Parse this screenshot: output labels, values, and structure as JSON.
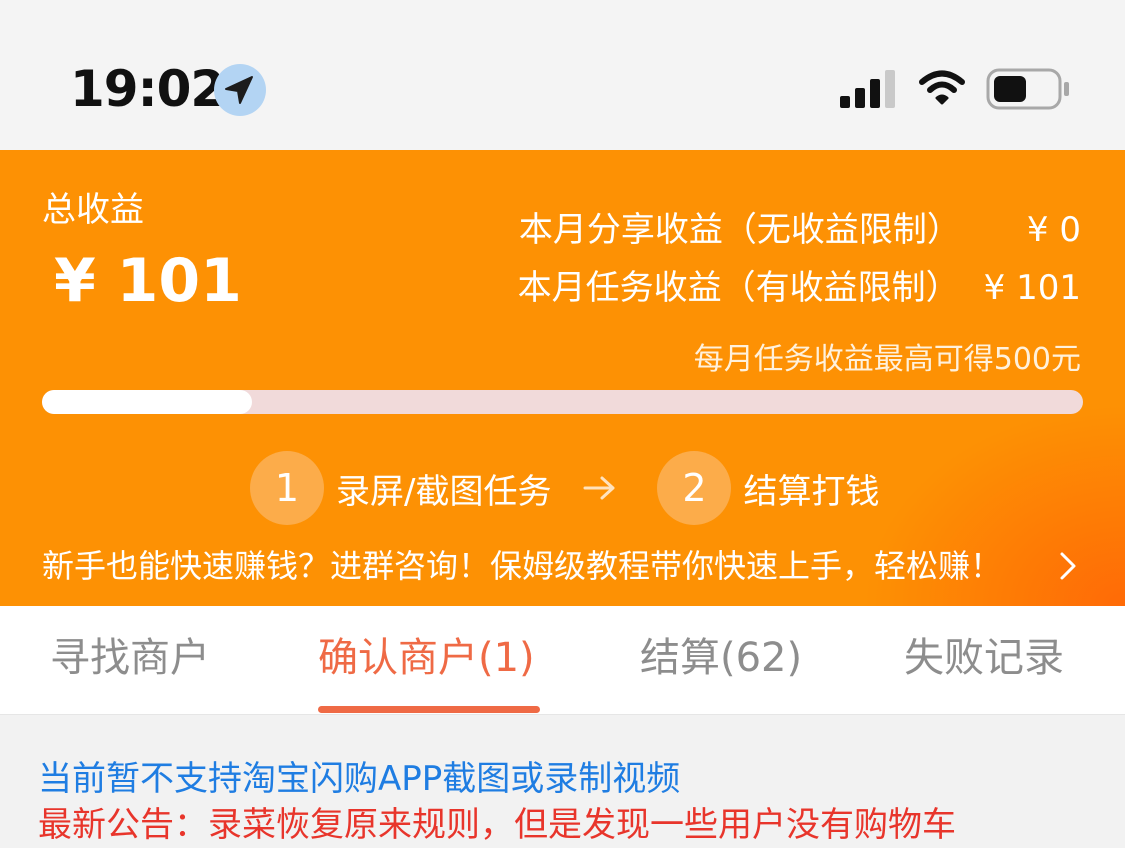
{
  "status_bar": {
    "time": "19:02",
    "icons": [
      "location-arrow-icon",
      "cellular-signal-icon",
      "wifi-icon",
      "battery-icon"
    ]
  },
  "earnings": {
    "total_label": "总收益",
    "total_value": "¥ 101",
    "share_label": "本月分享收益（无收益限制）",
    "share_value": "¥ 0",
    "task_label": "本月任务收益（有收益限制）",
    "task_value": "¥ 101",
    "monthly_max": "每月任务收益最高可得500元",
    "progress_fraction": 0.202
  },
  "steps": [
    {
      "number": "1",
      "label": "录屏/截图任务"
    },
    {
      "number": "2",
      "label": "结算打钱"
    }
  ],
  "promo_text": "新手也能快速赚钱？进群咨询！保姆级教程带你快速上手，轻松赚！",
  "tabs": [
    {
      "label": "寻找商户",
      "active": false
    },
    {
      "label": "确认商户(1)",
      "active": true
    },
    {
      "label": "结算(62)",
      "active": false
    },
    {
      "label": "失败记录",
      "active": false
    }
  ],
  "notice": {
    "line1": "当前暂不支持淘宝闪购APP截图或录制视频",
    "line2": "最新公告：录菜恢复原来规则，但是发现一些用户没有购物车"
  },
  "colors": {
    "banner_orange": "#fd9104",
    "banner_orange_dark": "#ff6a06",
    "active_tab": "#ef6a45",
    "notice_blue": "#1f7de2",
    "notice_red": "#e8352b",
    "inactive_tab": "#8d8d8d"
  }
}
